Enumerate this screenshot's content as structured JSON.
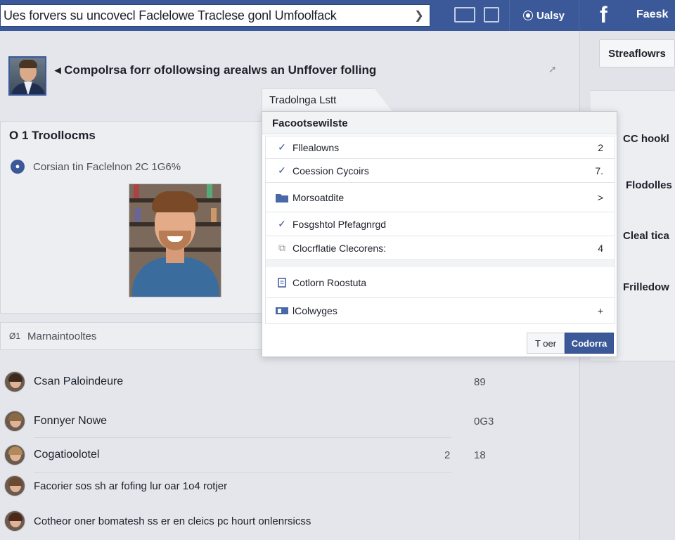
{
  "topbar": {
    "search_value": "Ues forvers su uncovecl Faclelowe Traclese gonl Umfoolfack",
    "user_label": "Ualsy",
    "brand_text": "Faesk"
  },
  "header": {
    "title": "Compolrsa forr ofollowsing arealws an Unffover folling"
  },
  "left_panel": {
    "heading": "O 1 Troollocms",
    "subtitle": "Corsian tin Faclelnon 2C 1G6%"
  },
  "management_bar": {
    "label": "Marnaintooltes",
    "icon_text": "Ø1"
  },
  "list": [
    {
      "name": "Csan Paloindeure",
      "count": "89",
      "count2": ""
    },
    {
      "name": "Fonnyer Nowe",
      "count": "0G3",
      "count2": ""
    },
    {
      "name": "Cogatioolotel",
      "count": "18",
      "count2": "2"
    },
    {
      "name": "Facorier sos sh ar fofing lur oar 1o4 rotjer",
      "count": "",
      "count2": ""
    },
    {
      "name": "Cotheor oner bomatesh ss er en cleics pc hourt onlenrsicss",
      "count": "",
      "count2": ""
    }
  ],
  "right_sidebar": {
    "button_label": "Streaflowrs",
    "items": [
      "CC hookl",
      "Flodolles",
      "Cleal tica",
      "Frilledow"
    ]
  },
  "dialog": {
    "tab_label": "Tradolnga Lstt",
    "header": "Facootsewilste",
    "rows": [
      {
        "icon": "check-icon",
        "glyph": "✓",
        "label": "Fllealowns",
        "count": "2"
      },
      {
        "icon": "check-icon",
        "glyph": "✓",
        "label": "Coession Cycoirs",
        "count": "7."
      },
      {
        "icon": "folder-icon",
        "glyph": "",
        "label": "Morsoatdite",
        "count": ">"
      },
      {
        "icon": "check-icon",
        "glyph": "✓",
        "label": "Fosgshtol Pfefagnrgd",
        "count": ""
      },
      {
        "icon": "image-icon",
        "glyph": "⧉",
        "label": "Clocrflatie Clecorens:",
        "count": "4"
      },
      {
        "icon": "document-icon",
        "glyph": "🗎",
        "label": "Cotlorn Roostuta",
        "count": ""
      },
      {
        "icon": "image-icon",
        "glyph": "",
        "label": "lColwyges",
        "count": "+"
      }
    ],
    "cancel_label": "T oer",
    "confirm_label": "Codorra"
  },
  "colors": {
    "brand": "#3b5998",
    "background": "#e4e6ec"
  }
}
